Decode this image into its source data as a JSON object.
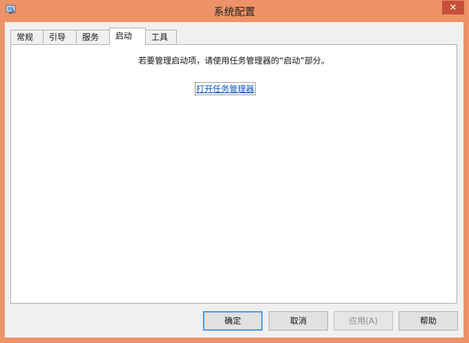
{
  "window": {
    "title": "系统配置",
    "close_glyph": "✕"
  },
  "tabs": [
    {
      "label": "常规",
      "active": false
    },
    {
      "label": "引导",
      "active": false
    },
    {
      "label": "服务",
      "active": false
    },
    {
      "label": "启动",
      "active": true
    },
    {
      "label": "工具",
      "active": false
    }
  ],
  "startup": {
    "message": "若要管理启动项，请使用任务管理器的“启动”部分。",
    "link_label": "打开任务管理器"
  },
  "buttons": {
    "ok": "确定",
    "cancel": "取消",
    "apply": "应用(A)",
    "help": "帮助"
  },
  "colors": {
    "frame": "#ee9268",
    "close": "#c7503a",
    "link": "#0a57b6"
  }
}
